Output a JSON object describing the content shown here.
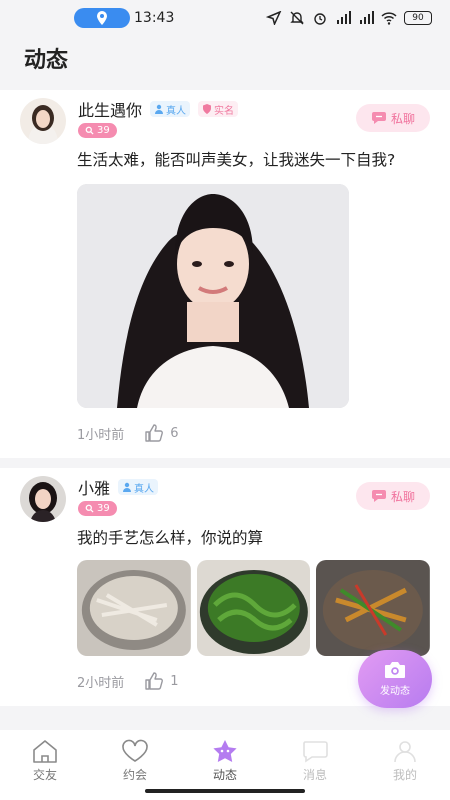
{
  "status_bar": {
    "time": "13:43",
    "battery": "90"
  },
  "page": {
    "title": "动态"
  },
  "posts": [
    {
      "username": "此生遇你",
      "tags": {
        "real": "真人",
        "verified": "实名"
      },
      "age": "39",
      "chat_label": "私聊",
      "text": "生活太难，能否叫声美女，让我迷失一下自我?",
      "time": "1小时前",
      "likes": "6"
    },
    {
      "username": "小雅",
      "tags": {
        "real": "真人"
      },
      "age": "39",
      "chat_label": "私聊",
      "text": "我的手艺怎么样，你说的算",
      "time": "2小时前",
      "likes": "1"
    }
  ],
  "fab": {
    "label": "发动态"
  },
  "tabs": [
    {
      "label": "交友",
      "icon": "home-icon"
    },
    {
      "label": "约会",
      "icon": "heart-icon"
    },
    {
      "label": "动态",
      "icon": "star-icon"
    },
    {
      "label": "消息",
      "icon": "message-icon"
    },
    {
      "label": "我的",
      "icon": "profile-icon"
    }
  ],
  "colors": {
    "accent_pink": "#f58cb0",
    "fab_purple": "#c187f2",
    "tag_blue": "#5aa8f0"
  }
}
